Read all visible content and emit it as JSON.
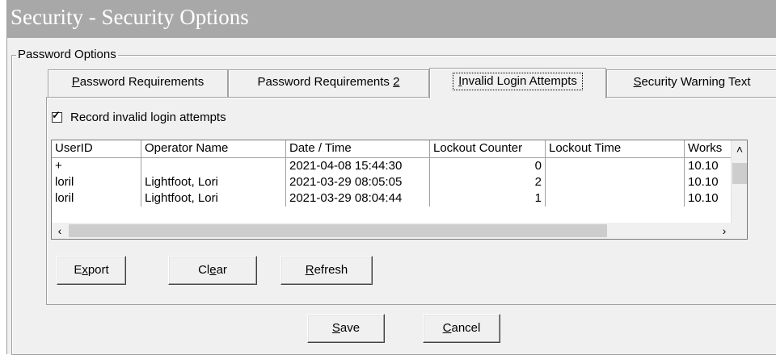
{
  "window": {
    "title": "Security - Security Options"
  },
  "password_options": {
    "legend": "Password Options",
    "tabs": [
      {
        "pre": "",
        "key": "P",
        "post": "assword Requirements",
        "active": false
      },
      {
        "pre": "Password Requirements ",
        "key": "2",
        "post": "",
        "active": false
      },
      {
        "pre": "",
        "key": "I",
        "post": "nvalid Login Attempts",
        "active": true
      },
      {
        "pre": "",
        "key": "S",
        "post": "ecurity Warning Text",
        "active": false
      }
    ],
    "record_checkbox": {
      "label": "Record invalid login attempts",
      "checked": true
    },
    "table": {
      "columns": [
        "UserID",
        "Operator Name",
        "Date / Time",
        "Lockout Counter",
        "Lockout Time",
        "Works"
      ],
      "rows": [
        [
          "+",
          "",
          "2021-04-08 15:44:30",
          "0",
          "",
          "10.10"
        ],
        [
          "loril",
          "Lightfoot, Lori",
          "2021-03-29 08:05:05",
          "2",
          "",
          "10.10"
        ],
        [
          "loril",
          "Lightfoot, Lori",
          "2021-03-29 08:04:44",
          "1",
          "",
          "10.10"
        ]
      ]
    },
    "buttons": {
      "export": {
        "pre": "E",
        "key": "x",
        "post": "port"
      },
      "clear": {
        "pre": "Cl",
        "key": "e",
        "post": "ar"
      },
      "refresh": {
        "pre": "",
        "key": "R",
        "post": "efresh"
      }
    }
  },
  "footer": {
    "save": {
      "pre": "",
      "key": "S",
      "post": "ave"
    },
    "cancel": {
      "pre": "",
      "key": "C",
      "post": "ancel"
    }
  },
  "icons": {
    "checkbox": "check-icon",
    "scroll_up": "chevron-up-icon",
    "scroll_left": "chevron-left-icon",
    "scroll_right": "chevron-right-icon"
  }
}
